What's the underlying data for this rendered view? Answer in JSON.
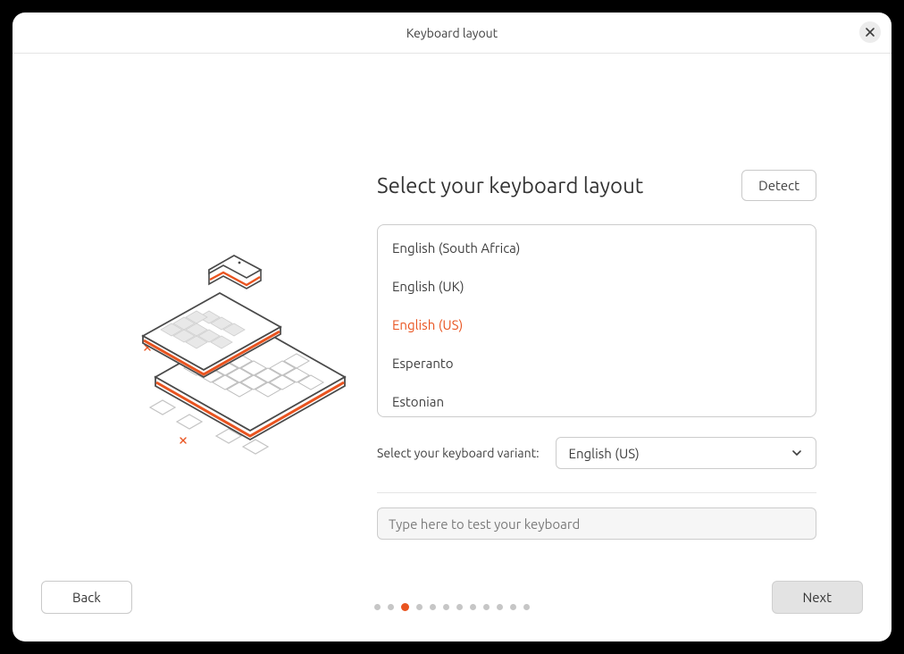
{
  "header": {
    "title": "Keyboard layout",
    "close_icon": "close"
  },
  "main": {
    "heading": "Select your keyboard layout",
    "detect_label": "Detect",
    "layouts": [
      {
        "label": "English (South Africa)",
        "selected": false
      },
      {
        "label": "English (UK)",
        "selected": false
      },
      {
        "label": "English (US)",
        "selected": true
      },
      {
        "label": "Esperanto",
        "selected": false
      },
      {
        "label": "Estonian",
        "selected": false
      }
    ],
    "variant_prompt": "Select your keyboard variant:",
    "variant_selected": "English (US)",
    "test_placeholder": "Type here to test your keyboard",
    "test_value": ""
  },
  "footer": {
    "back_label": "Back",
    "next_label": "Next"
  },
  "progress": {
    "total_steps": 12,
    "current_step": 3
  },
  "colors": {
    "accent": "#e95420",
    "text": "#3d3d3d",
    "border": "#cccccc",
    "muted_bg": "#f6f6f6"
  }
}
